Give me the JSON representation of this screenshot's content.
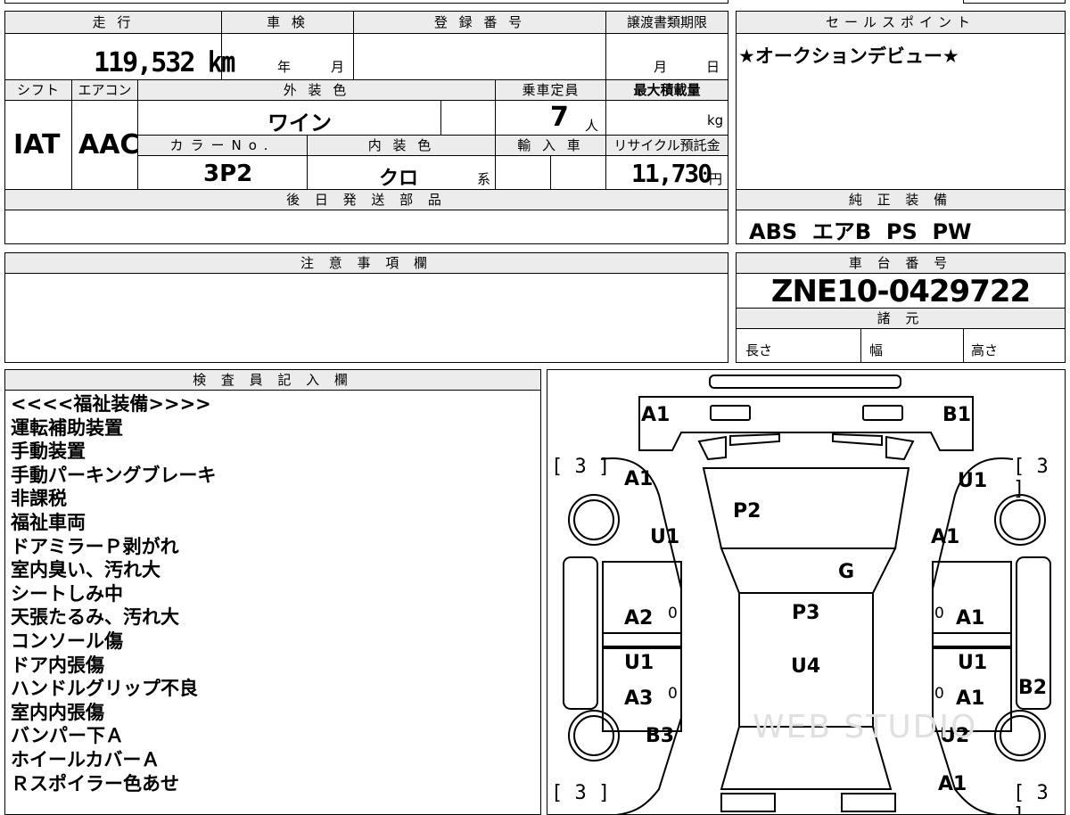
{
  "mileage": {
    "label": "走 行",
    "value": "119,532 ㎞"
  },
  "inspection": {
    "label": "車 検",
    "year_unit": "年",
    "month_unit": "月"
  },
  "registration": {
    "label": "登 録 番 号",
    "value": ""
  },
  "transfer_deadline": {
    "label": "譲渡書類期限",
    "month_unit": "月",
    "day_unit": "日"
  },
  "sales_point": {
    "label": "セールスポイント",
    "text": "★オークションデビュー★"
  },
  "shift": {
    "label": "シフト",
    "value": "IAT"
  },
  "aircon": {
    "label": "エアコン",
    "value": "AAC"
  },
  "exterior_color": {
    "label": "外 装 色",
    "value": "ワイン"
  },
  "capacity": {
    "label": "乗車定員",
    "value": "7",
    "unit": "人"
  },
  "max_load": {
    "label": "最大積載量",
    "unit": "kg"
  },
  "color_no": {
    "label": "カラーNo.",
    "value": "3P2"
  },
  "interior_color": {
    "label": "内 装 色",
    "value": "クロ",
    "unit": "系"
  },
  "import": {
    "label": "輸 入 車"
  },
  "recycle": {
    "label": "リサイクル預託金",
    "value": "11,730",
    "unit": "円"
  },
  "later_parts": {
    "label": "後 日 発 送 部 品",
    "value": ""
  },
  "genuine_equipment": {
    "label": "純 正 装 備",
    "value": "ABS  エアB  PS  PW"
  },
  "notes": {
    "label": "注 意 事 項 欄",
    "value": ""
  },
  "chassis": {
    "label": "車 台 番 号",
    "value": "ZNE10-0429722"
  },
  "specs": {
    "label": "諸 元",
    "length": "長さ",
    "width": "幅",
    "height": "高さ"
  },
  "inspector": {
    "label": "検 査 員 記 入 欄",
    "lines": [
      "<<<<福祉装備>>>>",
      "運転補助装置",
      "手動装置",
      "手動パーキングブレーキ",
      "非課税",
      "福祉車両",
      "ドアミラーＰ剥がれ",
      "室内臭い、汚れ大",
      "シートしみ中",
      "天張たるみ、汚れ大",
      "コンソール傷",
      "ドア内張傷",
      "ハンドルグリップ不良",
      "室内内張傷",
      "バンパー下Ａ",
      "ホイールカバーＡ",
      "Ｒスポイラー色あせ"
    ]
  },
  "diagram": {
    "tire_marks": [
      "[ 3 ]",
      "[ 3 ]",
      "[ 3 ]",
      "[ 3 ]"
    ],
    "marks": [
      "A1",
      "B1",
      "A1",
      "U1",
      "P2",
      "U1",
      "U1",
      "A1",
      "G",
      "A2",
      "P3",
      "A1",
      "U1",
      "U4",
      "U1",
      "A3",
      "A1",
      "B2",
      "B3",
      "U2",
      "A1"
    ],
    "zeros": [
      "0",
      "0",
      "0",
      "0"
    ],
    "watermark": "WEB STUDIO"
  }
}
